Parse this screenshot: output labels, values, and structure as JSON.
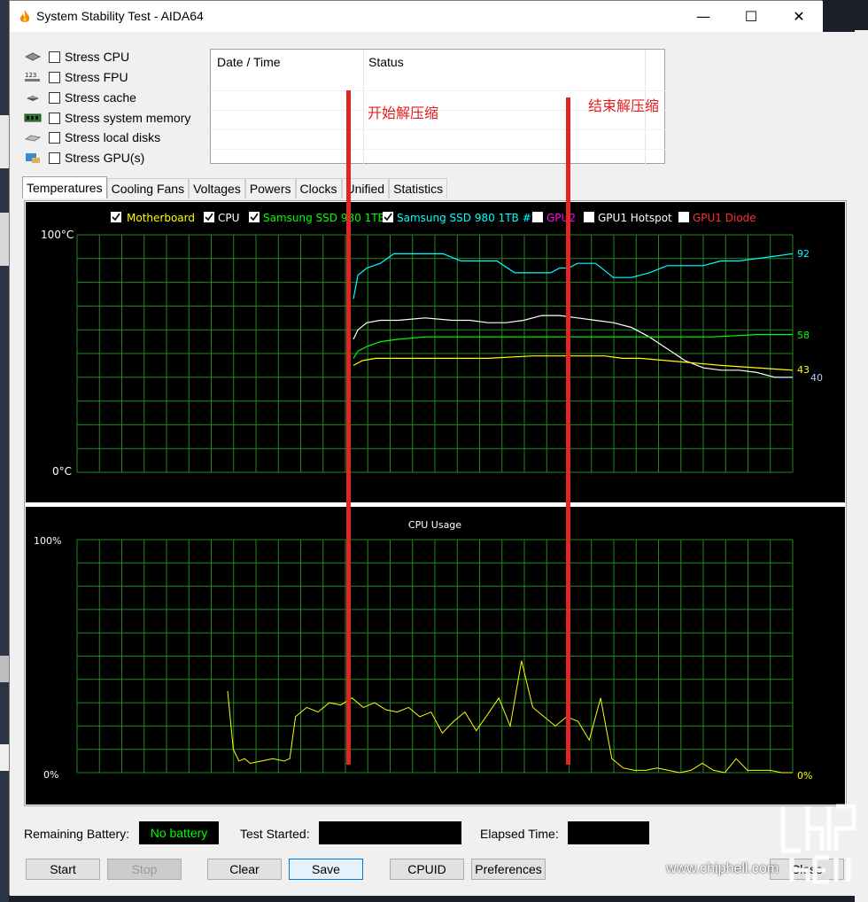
{
  "window": {
    "title": "System Stability Test - AIDA64",
    "minimize_glyph": "—",
    "maximize_glyph": "☐",
    "close_glyph": "✕"
  },
  "stress": [
    {
      "label": "Stress CPU",
      "checked": false,
      "icon": "cpu-chip-icon"
    },
    {
      "label": "Stress FPU",
      "checked": false,
      "icon": "fpu-123-icon"
    },
    {
      "label": "Stress cache",
      "checked": false,
      "icon": "cache-chip-icon"
    },
    {
      "label": "Stress system memory",
      "checked": false,
      "icon": "memory-module-icon"
    },
    {
      "label": "Stress local disks",
      "checked": false,
      "icon": "disk-drive-icon"
    },
    {
      "label": "Stress GPU(s)",
      "checked": false,
      "icon": "gpu-icon"
    }
  ],
  "log": {
    "col_date": "Date / Time",
    "col_status": "Status"
  },
  "tabs": [
    "Temperatures",
    "Cooling Fans",
    "Voltages",
    "Powers",
    "Clocks",
    "Unified",
    "Statistics"
  ],
  "active_tab": "Temperatures",
  "temperature_chart": {
    "legend": [
      {
        "label": "Motherboard",
        "checked": true,
        "color": "#ffff00"
      },
      {
        "label": "CPU",
        "checked": true,
        "color": "#ffffff"
      },
      {
        "label": "Samsung SSD 980 1TB",
        "checked": true,
        "color": "#00ff00"
      },
      {
        "label": "Samsung SSD 980 1TB #2",
        "checked": true,
        "color": "#00ffff"
      },
      {
        "label": "GPU2",
        "checked": false,
        "color": "#ff00ff"
      },
      {
        "label": "GPU1 Hotspot",
        "checked": false,
        "color": "#ffffff"
      },
      {
        "label": "GPU1 Diode",
        "checked": false,
        "color": "#ff2020"
      }
    ],
    "ymax_label": "100°C",
    "ymin_label": "0°C",
    "end_labels": [
      "92",
      "58",
      "43",
      "40"
    ]
  },
  "cpu_chart": {
    "title": "CPU Usage",
    "ymax_label": "100%",
    "ymin_label": "0%",
    "end_label": "0%"
  },
  "chart_data": [
    {
      "type": "line",
      "title": "",
      "ylabel": "°C",
      "ylim": [
        0,
        100
      ],
      "grid": true,
      "legend_placement": "top",
      "series": [
        {
          "name": "Samsung SSD 980 1TB #2",
          "color": "#00ffff",
          "x": [
            0,
            1,
            3,
            6,
            9,
            12,
            16,
            20,
            24,
            28,
            32,
            36,
            40,
            44,
            46,
            48,
            50,
            54,
            58,
            62,
            66,
            70,
            74,
            78,
            82,
            86,
            90,
            94,
            98
          ],
          "y": [
            73,
            83,
            86,
            88,
            92,
            92,
            92,
            92,
            89,
            89,
            89,
            84,
            84,
            84,
            86,
            86,
            88,
            88,
            82,
            82,
            84,
            87,
            87,
            87,
            89,
            89,
            90,
            91,
            92
          ]
        },
        {
          "name": "CPU",
          "color": "#ffffff",
          "x": [
            0,
            1,
            3,
            6,
            10,
            16,
            22,
            26,
            30,
            34,
            38,
            42,
            46,
            50,
            54,
            58,
            62,
            66,
            70,
            74,
            78,
            82,
            86,
            90,
            94,
            98
          ],
          "y": [
            56,
            60,
            63,
            64,
            64,
            65,
            64,
            64,
            63,
            63,
            64,
            66,
            66,
            65,
            64,
            63,
            61,
            57,
            52,
            47,
            44,
            43,
            43,
            42,
            40,
            40
          ]
        },
        {
          "name": "Samsung SSD 980 1TB",
          "color": "#00ff00",
          "x": [
            0,
            1,
            3,
            6,
            10,
            16,
            22,
            30,
            40,
            50,
            60,
            70,
            80,
            90,
            98
          ],
          "y": [
            48,
            51,
            53,
            55,
            56,
            57,
            57,
            57,
            57,
            57,
            57,
            57,
            57,
            58,
            58
          ]
        },
        {
          "name": "Motherboard",
          "color": "#ffff00",
          "x": [
            0,
            2,
            5,
            10,
            20,
            30,
            40,
            48,
            50,
            56,
            60,
            64,
            70,
            76,
            82,
            90,
            98
          ],
          "y": [
            45,
            47,
            48,
            48,
            48,
            48,
            49,
            49,
            49,
            49,
            48,
            48,
            47,
            46,
            45,
            44,
            43
          ]
        }
      ]
    },
    {
      "type": "line",
      "title": "CPU Usage",
      "ylabel": "%",
      "ylim": [
        0,
        100
      ],
      "grid": true,
      "series": [
        {
          "name": "",
          "color": "#ffff00",
          "x": [
            0,
            1,
            2,
            3,
            4,
            6,
            8,
            10,
            11,
            12,
            14,
            16,
            18,
            20,
            22,
            24,
            26,
            28,
            30,
            32,
            34,
            36,
            38,
            40,
            42,
            44,
            46,
            48,
            50,
            52,
            54,
            56,
            58,
            60,
            62,
            64,
            66,
            68,
            70,
            72,
            74,
            76,
            78,
            80,
            82,
            84,
            86,
            88,
            90,
            92,
            94,
            96,
            98,
            100
          ],
          "y": [
            35,
            10,
            5,
            6,
            4,
            5,
            6,
            5,
            6,
            24,
            28,
            26,
            30,
            29,
            32,
            28,
            30,
            27,
            26,
            28,
            24,
            26,
            17,
            22,
            26,
            18,
            25,
            32,
            20,
            48,
            28,
            24,
            20,
            24,
            22,
            14,
            32,
            6,
            2,
            1,
            1,
            2,
            1,
            0,
            1,
            4,
            1,
            0,
            6,
            1,
            1,
            1,
            0,
            0
          ]
        }
      ]
    }
  ],
  "annotations": {
    "start": "开始解压缩",
    "end": "结束解压缩"
  },
  "status": {
    "battery_label": "Remaining Battery:",
    "battery_value": "No battery",
    "test_started_label": "Test Started:",
    "elapsed_label": "Elapsed Time:"
  },
  "buttons": {
    "start": "Start",
    "stop": "Stop",
    "clear": "Clear",
    "save": "Save",
    "cpuid": "CPUID",
    "preferences": "Preferences",
    "close": "Close"
  },
  "watermark": {
    "site": "www.chiphell.com"
  }
}
